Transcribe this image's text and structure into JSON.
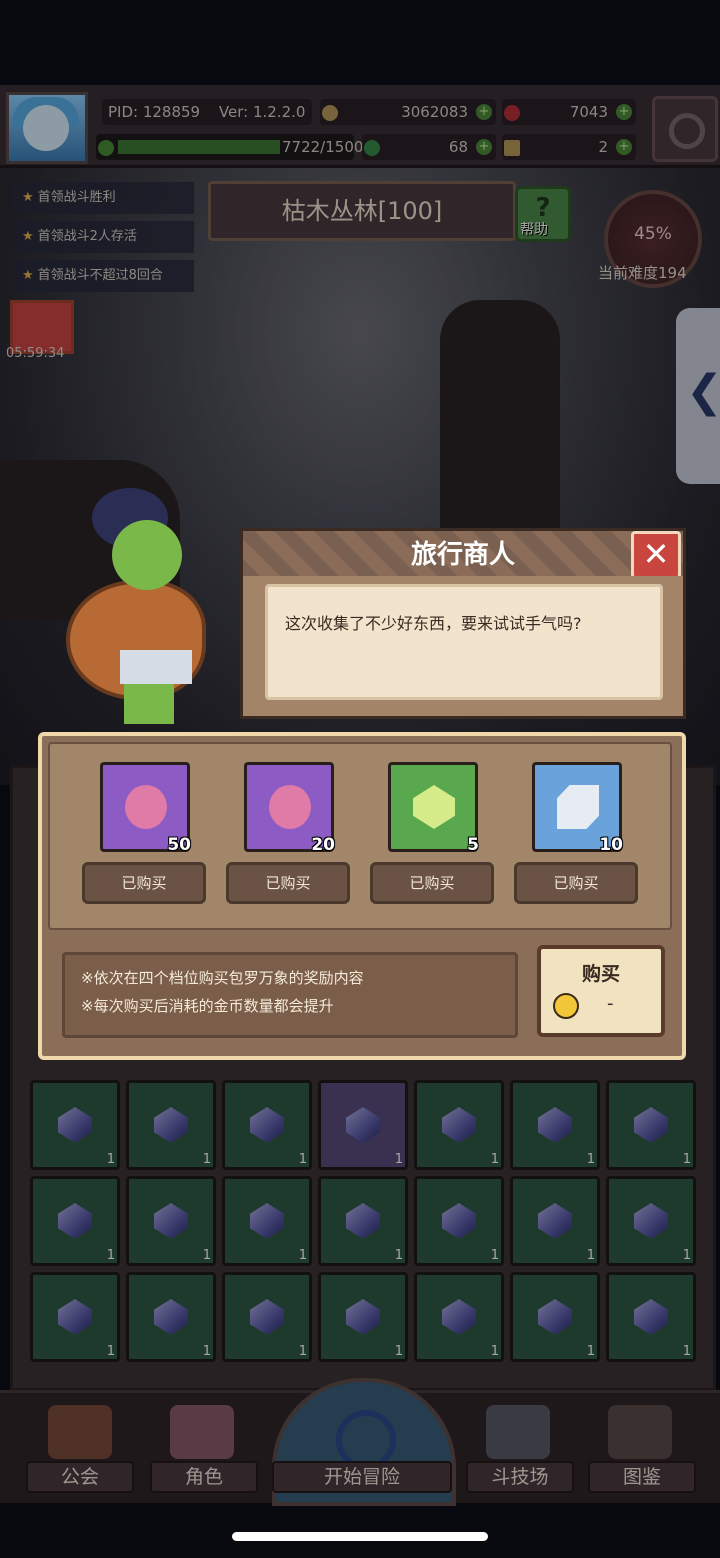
{
  "top": {
    "pid": "PID: 128859",
    "version": "Ver: 1.2.2.0",
    "gold": "3062083",
    "gems": "7043",
    "energy": "7722/1500",
    "clover": "68",
    "keys": "2"
  },
  "tasks": [
    "首领战斗胜利",
    "首领战斗2人存活",
    "首领战斗不超过8回合"
  ],
  "stage": {
    "name": "枯木丛林[100]",
    "help_label": "帮助",
    "difficulty_percent": "45%",
    "difficulty_label": "当前难度194"
  },
  "gift_timer": "05:59:34",
  "dialog": {
    "title": "旅行商人",
    "message": "这次收集了不少好东西，要来试试手气吗?"
  },
  "shop": {
    "items": [
      {
        "icon": "pink-fruit-icon",
        "count": "50",
        "status": "已购买",
        "color": "#8c5cc4"
      },
      {
        "icon": "pink-fruit-icon",
        "count": "20",
        "status": "已购买",
        "color": "#8c5cc4"
      },
      {
        "icon": "green-crystal-icon",
        "count": "5",
        "status": "已购买",
        "color": "#5aa84e"
      },
      {
        "icon": "silver-cube-icon",
        "count": "10",
        "status": "已购买",
        "color": "#6aa2dc"
      }
    ],
    "notes": [
      "※依次在四个档位购买包罗万象的奖励内容",
      "※每次购买后消耗的金币数量都会提升"
    ],
    "buy_label": "购买",
    "buy_price": "-"
  },
  "nav": [
    "公会",
    "角色",
    "开始冒险",
    "斗技场",
    "图鉴"
  ],
  "inventory_count": "1"
}
